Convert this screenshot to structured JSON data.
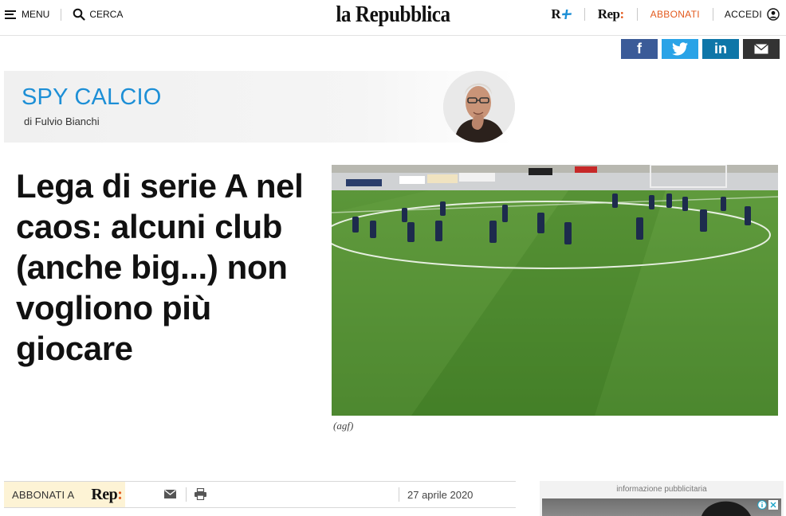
{
  "header": {
    "menu_label": "MENU",
    "search_label": "CERCA",
    "logo_text": "la Repubblica",
    "rplus_label": "R",
    "rep_label": "Rep",
    "rep_colon": ":",
    "subscribe_label": "ABBONATI",
    "login_label": "ACCEDI"
  },
  "share": {
    "facebook_icon": "f",
    "linkedin_icon": "in"
  },
  "blog": {
    "title": "SPY CALCIO",
    "author": "di Fulvio Bianchi"
  },
  "article": {
    "headline": "Lega di serie A nel caos: alcuni club (anche big...) non vogliono più giocare",
    "photo_caption": "(agf)",
    "date": "27 aprile 2020"
  },
  "subscribe_bar": {
    "label": "ABBONATI A",
    "rep_label": "Rep",
    "rep_colon": ":"
  },
  "ad": {
    "label": "informazione pubblicitaria"
  },
  "colors": {
    "accent_orange": "#e35a1e",
    "blog_blue": "#1d8fd6",
    "facebook": "#3b5b98",
    "twitter": "#29a3e7",
    "linkedin": "#0e76a8",
    "mail": "#333333"
  }
}
